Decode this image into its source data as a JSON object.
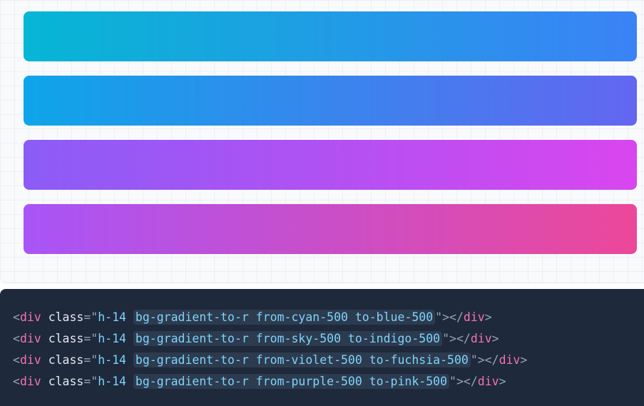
{
  "preview": {
    "bars": [
      {
        "from": "#06b6d4",
        "to": "#3b82f6"
      },
      {
        "from": "#0ea5e9",
        "to": "#6366f1"
      },
      {
        "from": "#8b5cf6",
        "to": "#d946ef"
      },
      {
        "from": "#a855f7",
        "to": "#ec4899"
      }
    ]
  },
  "code": {
    "tag": "div",
    "attr": "class",
    "base_class": "h-14",
    "lines": [
      {
        "classes": "bg-gradient-to-r from-cyan-500 to-blue-500"
      },
      {
        "classes": "bg-gradient-to-r from-sky-500 to-indigo-500"
      },
      {
        "classes": "bg-gradient-to-r from-violet-500 to-fuchsia-500"
      },
      {
        "classes": "bg-gradient-to-r from-purple-500 to-pink-500"
      }
    ]
  },
  "colors": {
    "code_background": "#1e293b",
    "tag_color": "#f472b6",
    "class_value_color": "#7dd3fc",
    "punctuation_color": "#94a3b8"
  }
}
